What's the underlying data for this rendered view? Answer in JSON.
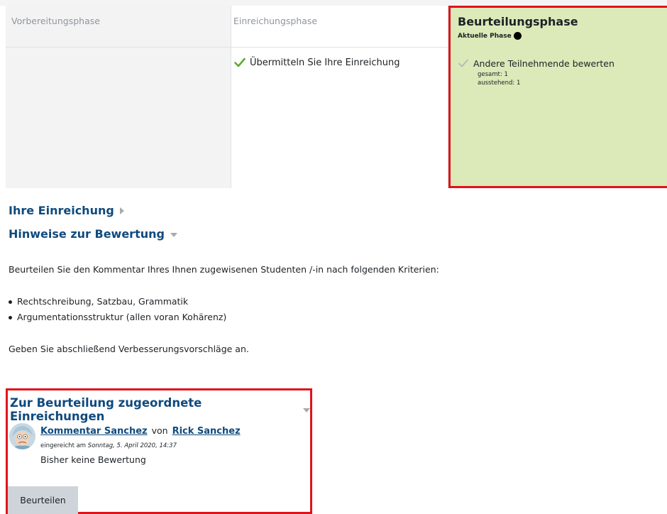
{
  "phases": {
    "setup": {
      "title": "Vorbereitungsphase"
    },
    "submission": {
      "title": "Einreichungsphase",
      "task": "Übermitteln Sie Ihre Einreichung"
    },
    "assessment": {
      "title": "Beurteilungsphase",
      "current_label": "Aktuelle Phase",
      "task": "Andere Teilnehmende bewerten",
      "total": "gesamt: 1",
      "pending": "ausstehend: 1",
      "highlight_color": "#dce9b9"
    }
  },
  "your_submission": {
    "heading": "Ihre Einreichung"
  },
  "instructions": {
    "heading": "Hinweise zur Bewertung",
    "intro": "Beurteilen Sie den Kommentar Ihres Ihnen zugewisenen Studenten /-in nach folgenden Kriterien:",
    "criteria": [
      "Rechtschreibung, Satzbau, Grammatik",
      "Argumentationsstruktur (allen voran Kohärenz)"
    ],
    "closing": "Geben Sie abschließend Verbesserungsvorschläge an."
  },
  "allocated": {
    "heading": "Zur Beurteilung zugeordnete Einreichungen",
    "submission_title": "Kommentar Sanchez",
    "by_word": "von",
    "author": "Rick Sanchez",
    "submitted_prefix": "eingereicht am",
    "submitted_date": "Sonntag, 5. April 2020, 14:37",
    "grade_status": "Bisher keine Bewertung",
    "assess_button": "Beurteilen"
  },
  "colors": {
    "heading_blue": "#0f4a7d",
    "highlight_red": "#e0131b",
    "check_green": "#5fa936"
  }
}
